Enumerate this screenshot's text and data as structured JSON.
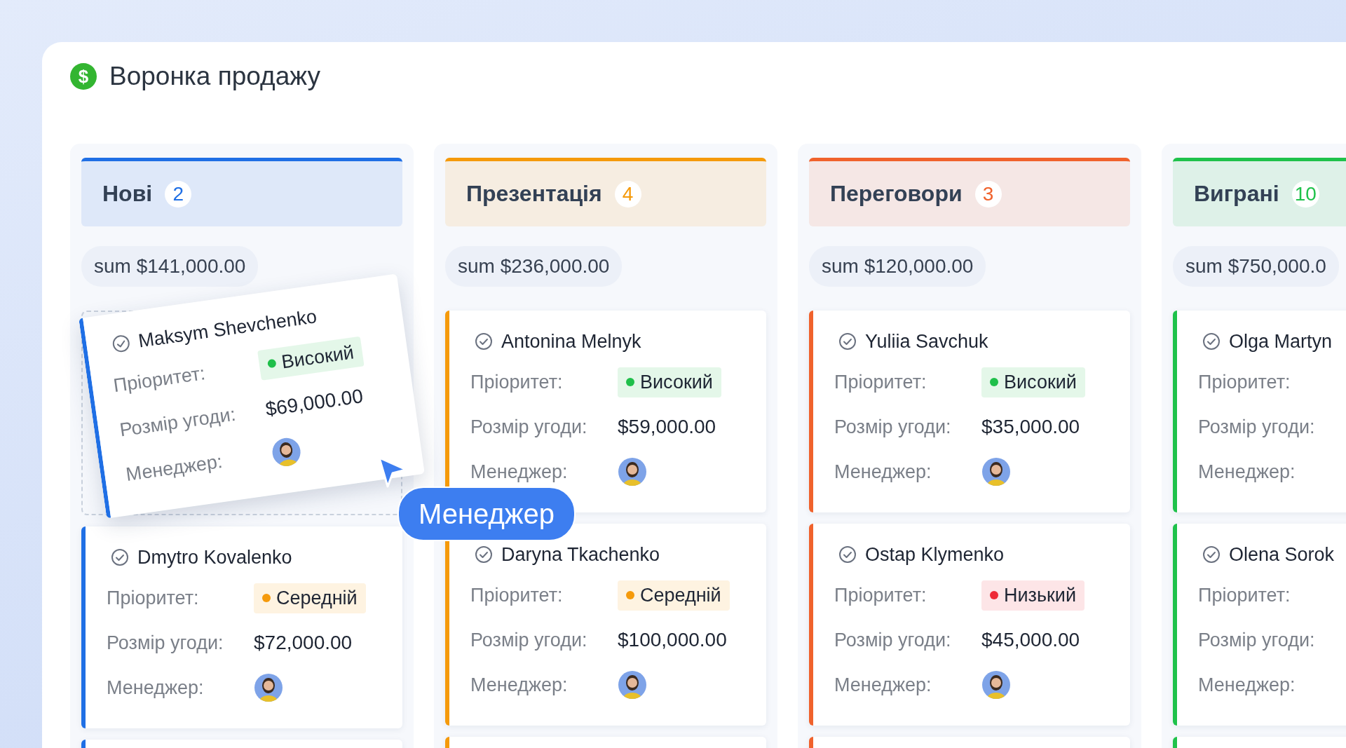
{
  "title": {
    "icon": "$",
    "text": "Воронка продажу"
  },
  "columns": [
    {
      "name": "Нові",
      "count": "2",
      "color": "#1f6fe5",
      "sum": "sum $141,000.00",
      "cards": [
        {
          "name": "Maksym Shevchenko",
          "dragging": true,
          "fields": [
            {
              "kind": "priority",
              "label": "Пріоритет:",
              "text": "Високий",
              "color": "#1fbf4a"
            },
            {
              "kind": "amount",
              "label": "Розмір угоди:",
              "text": "$69,000.00"
            },
            {
              "kind": "manager",
              "label": "Менеджер:",
              "avatar": true
            }
          ]
        },
        {
          "name": "Dmytro Kovalenko",
          "dragging": false,
          "fields": [
            {
              "kind": "priority",
              "label": "Пріоритет:",
              "text": "Середній",
              "color": "#f59a0b"
            },
            {
              "kind": "amount",
              "label": "Розмір угоди:",
              "text": "$72,000.00"
            },
            {
              "kind": "manager",
              "label": "Менеджер:",
              "avatar": true
            }
          ]
        }
      ]
    },
    {
      "name": "Презентація",
      "count": "4",
      "color": "#f59a0b",
      "sum": "sum $236,000.00",
      "cards": [
        {
          "name": "Antonina Melnyk",
          "dragging": false,
          "fields": [
            {
              "kind": "priority",
              "label": "Пріоритет:",
              "text": "Високий",
              "color": "#1fbf4a"
            },
            {
              "kind": "amount",
              "label": "Розмір угоди:",
              "text": "$59,000.00"
            },
            {
              "kind": "manager",
              "label": "Менеджер:",
              "avatar": true
            }
          ]
        },
        {
          "name": "Daryna Tkachenko",
          "dragging": false,
          "fields": [
            {
              "kind": "priority",
              "label": "Пріоритет:",
              "text": "Середній",
              "color": "#f59a0b"
            },
            {
              "kind": "amount",
              "label": "Розмір угоди:",
              "text": "$100,000.00"
            },
            {
              "kind": "manager",
              "label": "Менеджер:",
              "avatar": true
            }
          ]
        }
      ]
    },
    {
      "name": "Переговори",
      "count": "3",
      "color": "#f0622c",
      "sum": "sum $120,000.00",
      "cards": [
        {
          "name": "Yuliia Savchuk",
          "dragging": false,
          "fields": [
            {
              "kind": "priority",
              "label": "Пріоритет:",
              "text": "Високий",
              "color": "#1fbf4a"
            },
            {
              "kind": "amount",
              "label": "Розмір угоди:",
              "text": "$35,000.00"
            },
            {
              "kind": "manager",
              "label": "Менеджер:",
              "avatar": true
            }
          ]
        },
        {
          "name": "Ostap Klymenko",
          "dragging": false,
          "fields": [
            {
              "kind": "priority",
              "label": "Пріоритет:",
              "text": "Низький",
              "color": "#ee2a36"
            },
            {
              "kind": "amount",
              "label": "Розмір угоди:",
              "text": "$45,000.00"
            },
            {
              "kind": "manager",
              "label": "Менеджер:",
              "avatar": true
            }
          ]
        }
      ]
    },
    {
      "name": "Виграні",
      "count": "10",
      "color": "#1fc24b",
      "sum": "sum $750,000.0",
      "cards": [
        {
          "name": "Olga Martyn",
          "dragging": false,
          "fields": [
            {
              "kind": "priority",
              "label": "Пріоритет:"
            },
            {
              "kind": "amount",
              "label": "Розмір угоди:"
            },
            {
              "kind": "manager",
              "label": "Менеджер:"
            }
          ]
        },
        {
          "name": "Olena Sorok",
          "dragging": false,
          "fields": [
            {
              "kind": "priority",
              "label": "Пріоритет:"
            },
            {
              "kind": "amount",
              "label": "Розмір угоди:"
            },
            {
              "kind": "manager",
              "label": "Менеджер:"
            }
          ]
        }
      ]
    }
  ],
  "drag_tooltip": {
    "text": "Менеджер"
  }
}
